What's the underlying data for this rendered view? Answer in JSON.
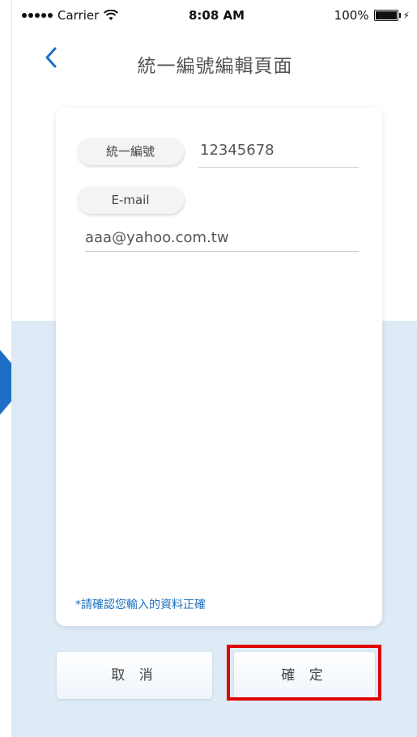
{
  "status_bar": {
    "carrier": "Carrier",
    "time": "8:08 AM",
    "battery": "100%"
  },
  "nav": {
    "title": "統一編號編輯頁面"
  },
  "form": {
    "tax_id": {
      "label": "統一編號",
      "value": "12345678"
    },
    "email": {
      "label": "E-mail",
      "value": "aaa@yahoo.com.tw"
    },
    "note": "*請確認您輸入的資料正確"
  },
  "buttons": {
    "cancel": "取 消",
    "confirm": "確 定"
  },
  "colors": {
    "accent_blue": "#1d6ec7",
    "highlight_red": "#e00000",
    "background_lower": "#deebf6"
  }
}
